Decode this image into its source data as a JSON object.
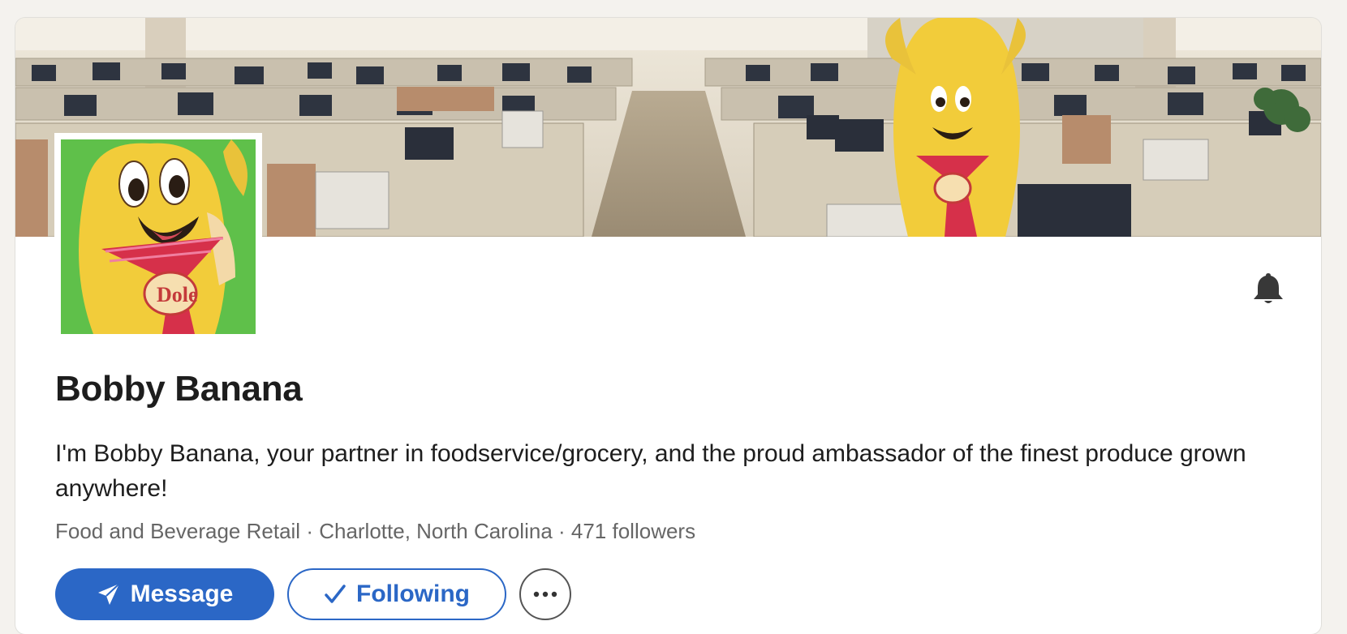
{
  "profile": {
    "name": "Bobby Banana",
    "tagline": "I'm Bobby Banana, your partner in foodservice/grocery, and the proud ambassador of the finest produce grown anywhere!",
    "industry": "Food and Beverage Retail",
    "location": "Charlotte, North Carolina",
    "followers": "471 followers",
    "separator": " · "
  },
  "actions": {
    "message_label": "Message",
    "following_label": "Following",
    "more_icon": "ellipsis-icon",
    "notify_icon": "bell-icon"
  },
  "colors": {
    "primary": "#2b67c6",
    "page_bg": "#f4f2ee",
    "text": "#1d1d1d",
    "muted": "#666666",
    "avatar_bg": "#5fc04a"
  },
  "images": {
    "cover": "office-cubicles-with-banana-mascot",
    "avatar": "banana-mascot-with-red-tie",
    "logo_text": "Dole"
  }
}
